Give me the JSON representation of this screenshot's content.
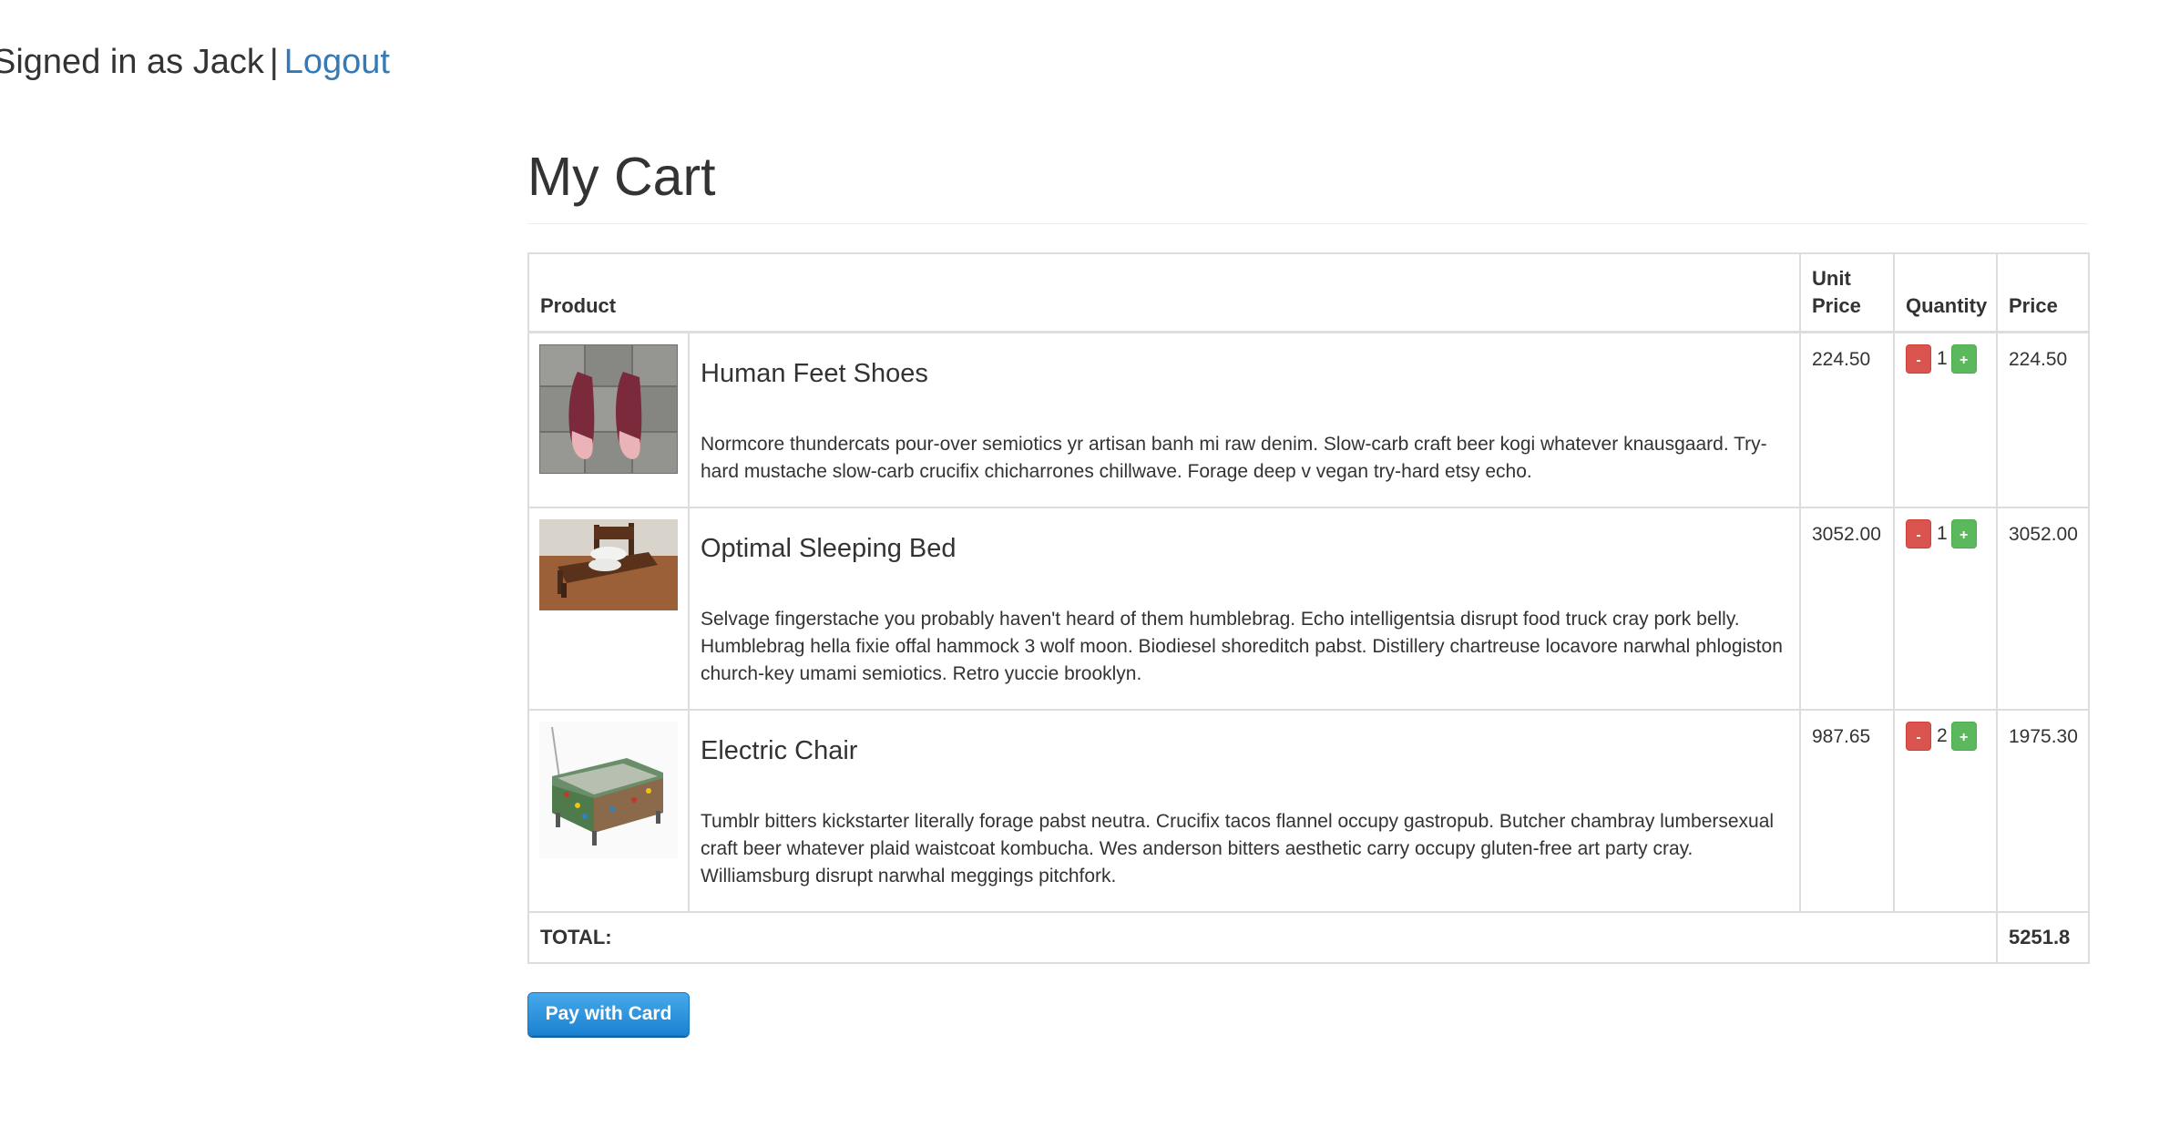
{
  "header": {
    "signed_in_text": "Signed in as Jack",
    "separator": "|",
    "logout_label": "Logout"
  },
  "page": {
    "title": "My Cart"
  },
  "table": {
    "columns": [
      "Product",
      "Unit Price",
      "Quantity",
      "Price"
    ],
    "items": [
      {
        "name": "Human Feet Shoes",
        "description": "Normcore thundercats pour-over semiotics yr artisan banh mi raw denim. Slow-carb craft beer kogi whatever knausgaard. Try-hard mustache slow-carb crucifix chicharrones chillwave. Forage deep v vegan try-hard etsy echo.",
        "unit_price": "224.50",
        "quantity": "1",
        "price": "224.50",
        "image_icon": "shoes-photo"
      },
      {
        "name": "Optimal Sleeping Bed",
        "description": "Selvage fingerstache you probably haven't heard of them humblebrag. Echo intelligentsia disrupt food truck cray pork belly. Humblebrag hella fixie offal hammock 3 wolf moon. Biodiesel shoreditch pabst. Distillery chartreuse locavore narwhal phlogiston church-key umami semiotics. Retro yuccie brooklyn.",
        "unit_price": "3052.00",
        "quantity": "1",
        "price": "3052.00",
        "image_icon": "bed-photo"
      },
      {
        "name": "Electric Chair",
        "description": "Tumblr bitters kickstarter literally forage pabst neutra. Crucifix tacos flannel occupy gastropub. Butcher chambray lumbersexual craft beer whatever plaid waistcoat kombucha. Wes anderson bitters aesthetic carry occupy gluten-free art party cray. Williamsburg disrupt narwhal meggings pitchfork.",
        "unit_price": "987.65",
        "quantity": "2",
        "price": "1975.30",
        "image_icon": "chair-photo"
      }
    ],
    "minus_label": "-",
    "plus_label": "+",
    "total_label": "TOTAL:",
    "total_value": "5251.8"
  },
  "actions": {
    "pay_label": "Pay with Card"
  },
  "colors": {
    "link": "#337ab7",
    "danger": "#d9534f",
    "success": "#5cb85c",
    "pay_button": "#1a82d1",
    "border": "#dddddd"
  }
}
